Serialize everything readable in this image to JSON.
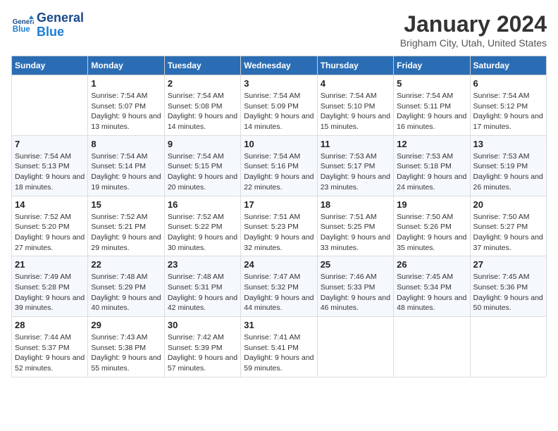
{
  "header": {
    "logo_line1": "General",
    "logo_line2": "Blue",
    "month": "January 2024",
    "location": "Brigham City, Utah, United States"
  },
  "weekdays": [
    "Sunday",
    "Monday",
    "Tuesday",
    "Wednesday",
    "Thursday",
    "Friday",
    "Saturday"
  ],
  "weeks": [
    [
      {
        "day": "",
        "sunrise": "",
        "sunset": "",
        "daylight": ""
      },
      {
        "day": "1",
        "sunrise": "Sunrise: 7:54 AM",
        "sunset": "Sunset: 5:07 PM",
        "daylight": "Daylight: 9 hours and 13 minutes."
      },
      {
        "day": "2",
        "sunrise": "Sunrise: 7:54 AM",
        "sunset": "Sunset: 5:08 PM",
        "daylight": "Daylight: 9 hours and 14 minutes."
      },
      {
        "day": "3",
        "sunrise": "Sunrise: 7:54 AM",
        "sunset": "Sunset: 5:09 PM",
        "daylight": "Daylight: 9 hours and 14 minutes."
      },
      {
        "day": "4",
        "sunrise": "Sunrise: 7:54 AM",
        "sunset": "Sunset: 5:10 PM",
        "daylight": "Daylight: 9 hours and 15 minutes."
      },
      {
        "day": "5",
        "sunrise": "Sunrise: 7:54 AM",
        "sunset": "Sunset: 5:11 PM",
        "daylight": "Daylight: 9 hours and 16 minutes."
      },
      {
        "day": "6",
        "sunrise": "Sunrise: 7:54 AM",
        "sunset": "Sunset: 5:12 PM",
        "daylight": "Daylight: 9 hours and 17 minutes."
      }
    ],
    [
      {
        "day": "7",
        "sunrise": "Sunrise: 7:54 AM",
        "sunset": "Sunset: 5:13 PM",
        "daylight": "Daylight: 9 hours and 18 minutes."
      },
      {
        "day": "8",
        "sunrise": "Sunrise: 7:54 AM",
        "sunset": "Sunset: 5:14 PM",
        "daylight": "Daylight: 9 hours and 19 minutes."
      },
      {
        "day": "9",
        "sunrise": "Sunrise: 7:54 AM",
        "sunset": "Sunset: 5:15 PM",
        "daylight": "Daylight: 9 hours and 20 minutes."
      },
      {
        "day": "10",
        "sunrise": "Sunrise: 7:54 AM",
        "sunset": "Sunset: 5:16 PM",
        "daylight": "Daylight: 9 hours and 22 minutes."
      },
      {
        "day": "11",
        "sunrise": "Sunrise: 7:53 AM",
        "sunset": "Sunset: 5:17 PM",
        "daylight": "Daylight: 9 hours and 23 minutes."
      },
      {
        "day": "12",
        "sunrise": "Sunrise: 7:53 AM",
        "sunset": "Sunset: 5:18 PM",
        "daylight": "Daylight: 9 hours and 24 minutes."
      },
      {
        "day": "13",
        "sunrise": "Sunrise: 7:53 AM",
        "sunset": "Sunset: 5:19 PM",
        "daylight": "Daylight: 9 hours and 26 minutes."
      }
    ],
    [
      {
        "day": "14",
        "sunrise": "Sunrise: 7:52 AM",
        "sunset": "Sunset: 5:20 PM",
        "daylight": "Daylight: 9 hours and 27 minutes."
      },
      {
        "day": "15",
        "sunrise": "Sunrise: 7:52 AM",
        "sunset": "Sunset: 5:21 PM",
        "daylight": "Daylight: 9 hours and 29 minutes."
      },
      {
        "day": "16",
        "sunrise": "Sunrise: 7:52 AM",
        "sunset": "Sunset: 5:22 PM",
        "daylight": "Daylight: 9 hours and 30 minutes."
      },
      {
        "day": "17",
        "sunrise": "Sunrise: 7:51 AM",
        "sunset": "Sunset: 5:23 PM",
        "daylight": "Daylight: 9 hours and 32 minutes."
      },
      {
        "day": "18",
        "sunrise": "Sunrise: 7:51 AM",
        "sunset": "Sunset: 5:25 PM",
        "daylight": "Daylight: 9 hours and 33 minutes."
      },
      {
        "day": "19",
        "sunrise": "Sunrise: 7:50 AM",
        "sunset": "Sunset: 5:26 PM",
        "daylight": "Daylight: 9 hours and 35 minutes."
      },
      {
        "day": "20",
        "sunrise": "Sunrise: 7:50 AM",
        "sunset": "Sunset: 5:27 PM",
        "daylight": "Daylight: 9 hours and 37 minutes."
      }
    ],
    [
      {
        "day": "21",
        "sunrise": "Sunrise: 7:49 AM",
        "sunset": "Sunset: 5:28 PM",
        "daylight": "Daylight: 9 hours and 39 minutes."
      },
      {
        "day": "22",
        "sunrise": "Sunrise: 7:48 AM",
        "sunset": "Sunset: 5:29 PM",
        "daylight": "Daylight: 9 hours and 40 minutes."
      },
      {
        "day": "23",
        "sunrise": "Sunrise: 7:48 AM",
        "sunset": "Sunset: 5:31 PM",
        "daylight": "Daylight: 9 hours and 42 minutes."
      },
      {
        "day": "24",
        "sunrise": "Sunrise: 7:47 AM",
        "sunset": "Sunset: 5:32 PM",
        "daylight": "Daylight: 9 hours and 44 minutes."
      },
      {
        "day": "25",
        "sunrise": "Sunrise: 7:46 AM",
        "sunset": "Sunset: 5:33 PM",
        "daylight": "Daylight: 9 hours and 46 minutes."
      },
      {
        "day": "26",
        "sunrise": "Sunrise: 7:45 AM",
        "sunset": "Sunset: 5:34 PM",
        "daylight": "Daylight: 9 hours and 48 minutes."
      },
      {
        "day": "27",
        "sunrise": "Sunrise: 7:45 AM",
        "sunset": "Sunset: 5:36 PM",
        "daylight": "Daylight: 9 hours and 50 minutes."
      }
    ],
    [
      {
        "day": "28",
        "sunrise": "Sunrise: 7:44 AM",
        "sunset": "Sunset: 5:37 PM",
        "daylight": "Daylight: 9 hours and 52 minutes."
      },
      {
        "day": "29",
        "sunrise": "Sunrise: 7:43 AM",
        "sunset": "Sunset: 5:38 PM",
        "daylight": "Daylight: 9 hours and 55 minutes."
      },
      {
        "day": "30",
        "sunrise": "Sunrise: 7:42 AM",
        "sunset": "Sunset: 5:39 PM",
        "daylight": "Daylight: 9 hours and 57 minutes."
      },
      {
        "day": "31",
        "sunrise": "Sunrise: 7:41 AM",
        "sunset": "Sunset: 5:41 PM",
        "daylight": "Daylight: 9 hours and 59 minutes."
      },
      {
        "day": "",
        "sunrise": "",
        "sunset": "",
        "daylight": ""
      },
      {
        "day": "",
        "sunrise": "",
        "sunset": "",
        "daylight": ""
      },
      {
        "day": "",
        "sunrise": "",
        "sunset": "",
        "daylight": ""
      }
    ]
  ]
}
